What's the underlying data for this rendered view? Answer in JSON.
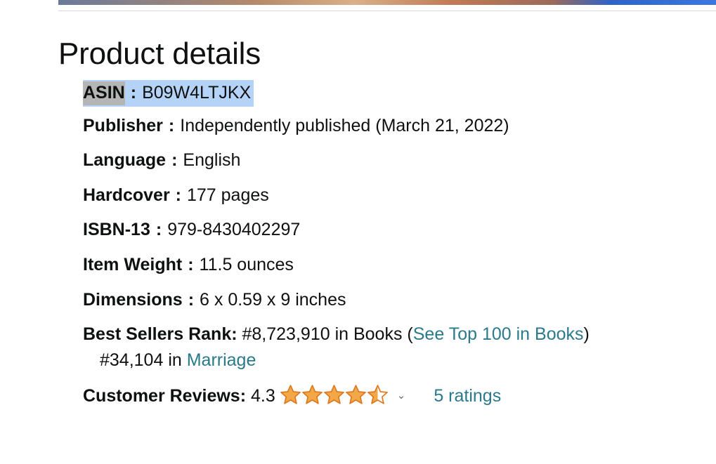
{
  "title": "Product details",
  "details": {
    "asin": {
      "key": "ASIN",
      "sep": ":",
      "value": "B09W4LTJKX"
    },
    "publisher": {
      "key": "Publisher",
      "sep": ":",
      "value": "Independently published (March 21, 2022)"
    },
    "language": {
      "key": "Language",
      "sep": ":",
      "value": "English"
    },
    "hardcover": {
      "key": "Hardcover",
      "sep": ":",
      "value": "177 pages"
    },
    "isbn13": {
      "key": "ISBN-13",
      "sep": ":",
      "value": "979-8430402297"
    },
    "weight": {
      "key": "Item Weight",
      "sep": ":",
      "value": "11.5 ounces"
    },
    "dimensions": {
      "key": "Dimensions",
      "sep": ":",
      "value": "6 x 0.59 x 9 inches"
    }
  },
  "rank": {
    "label": "Best Sellers Rank:",
    "books_rank": "#8,723,910 in Books (",
    "top100_link": "See Top 100 in Books",
    "close_paren": ")",
    "sub_rank": "#34,104 in ",
    "sub_category_link": "Marriage"
  },
  "reviews": {
    "label": "Customer Reviews:",
    "score": "4.3",
    "stars_value": 4.3,
    "stars_max": 5,
    "ratings_link": "5 ratings"
  },
  "colors": {
    "star": "#f3a847",
    "star_outline": "#de7921",
    "link": "#2a7a8b",
    "selection": "#b4d3f7"
  }
}
